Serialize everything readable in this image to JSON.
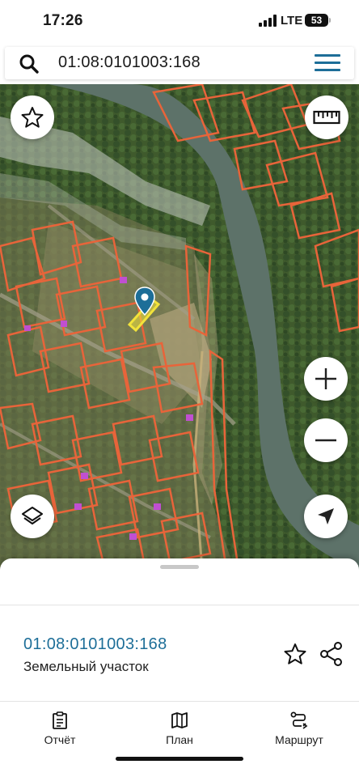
{
  "status_bar": {
    "time": "17:26",
    "network": "LTE",
    "battery": "53"
  },
  "search": {
    "query": "01:08:0101003:168",
    "icon": "search-icon",
    "menu_icon": "hamburger-menu-icon"
  },
  "map": {
    "controls": {
      "favorite": "star-icon",
      "ruler": "ruler-icon",
      "zoom_in": "plus-icon",
      "zoom_out": "minus-icon",
      "layers": "layers-icon",
      "locate": "navigation-arrow-icon"
    },
    "colors": {
      "parcel_outline": "#e8643a",
      "selected_parcel": "#f2e33a",
      "pin": "#1d6e98",
      "river": "#5d7269"
    }
  },
  "sheet": {
    "parcel_id": "01:08:0101003:168",
    "parcel_type": "Земельный участок"
  },
  "bottom_tabs": [
    {
      "label": "Отчёт",
      "icon": "report-icon"
    },
    {
      "label": "План",
      "icon": "map-plan-icon"
    },
    {
      "label": "Маршрут",
      "icon": "route-icon"
    }
  ]
}
